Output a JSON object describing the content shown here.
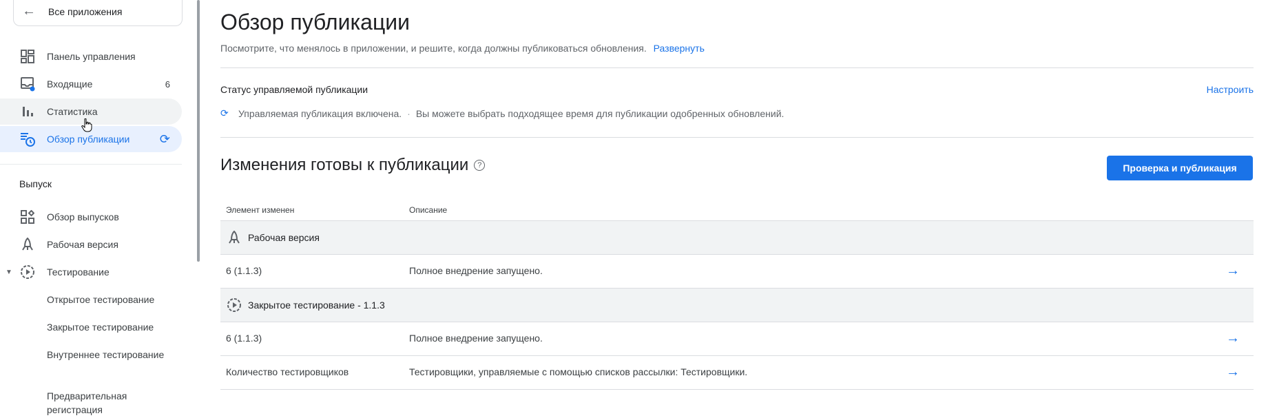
{
  "sidebar": {
    "back_label": "Все приложения",
    "items": [
      {
        "label": "Панель управления",
        "icon": "dashboard-icon"
      },
      {
        "label": "Входящие",
        "icon": "inbox-icon",
        "count": "6"
      },
      {
        "label": "Статистика",
        "icon": "bar-chart-icon"
      },
      {
        "label": "Обзор публикации",
        "icon": "publishing-overview-icon"
      }
    ],
    "release_section": "Выпуск",
    "release_items": [
      {
        "label": "Обзор выпусков",
        "icon": "releases-overview-icon"
      },
      {
        "label": "Рабочая версия",
        "icon": "rocket-icon"
      },
      {
        "label": "Тестирование",
        "icon": "testing-icon"
      }
    ],
    "testing_subitems": [
      "Открытое тестирование",
      "Закрытое тестирование",
      "Внутреннее тестирование",
      "Предварительная регистрация"
    ]
  },
  "main": {
    "title": "Обзор публикации",
    "subtitle": "Посмотрите, что менялось в приложении, и решите, когда должны публиковаться обновления.",
    "expand_link": "Развернуть",
    "status": {
      "title": "Статус управляемой публикации",
      "configure": "Настроить",
      "enabled_text": "Управляемая публикация включена.",
      "hint": "Вы можете выбрать подходящее время для публикации одобренных обновлений."
    },
    "changes": {
      "title": "Изменения готовы к публикации",
      "review_button": "Проверка и публикация",
      "col_element": "Элемент изменен",
      "col_description": "Описание",
      "groups": [
        {
          "name": "Рабочая версия",
          "rows": [
            {
              "element": "6 (1.1.3)",
              "description": "Полное внедрение запущено."
            }
          ]
        },
        {
          "name": "Закрытое тестирование - 1.1.3",
          "rows": [
            {
              "element": "6 (1.1.3)",
              "description": "Полное внедрение запущено."
            },
            {
              "element": "Количество тестировщиков",
              "description": "Тестировщики, управляемые с помощью списков рассылки: Тестировщики."
            }
          ]
        }
      ]
    }
  },
  "colors": {
    "accent": "#1a73e8",
    "active_bg": "#e8f0fe",
    "group_bg": "#f1f3f4"
  }
}
